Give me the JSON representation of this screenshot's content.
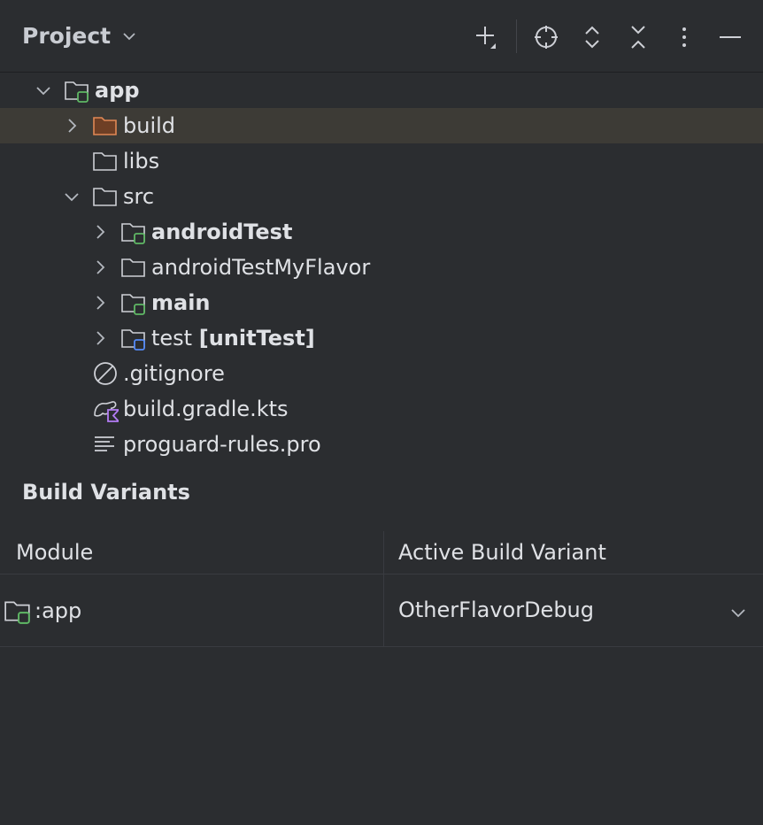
{
  "header": {
    "title": "Project",
    "toolbar": {
      "add_icon": "plus-icon",
      "locate_icon": "crosshair-icon",
      "expand_icon": "expand-all-icon",
      "collapse_icon": "collapse-all-icon",
      "more_icon": "more-vertical-icon",
      "hide_icon": "minimize-icon"
    }
  },
  "tree": {
    "app": {
      "label": "app"
    },
    "build": {
      "label": "build"
    },
    "libs": {
      "label": "libs"
    },
    "src": {
      "label": "src"
    },
    "androidTest": {
      "label": "androidTest"
    },
    "androidTestMyFlavor": {
      "label": "androidTestMyFlavor"
    },
    "main": {
      "label": "main"
    },
    "test": {
      "label": "test",
      "suffix": "[unitTest]"
    },
    "gitignore": {
      "label": ".gitignore"
    },
    "gradle": {
      "label": "build.gradle.kts"
    },
    "proguard": {
      "label": "proguard-rules.pro"
    }
  },
  "build_variants": {
    "title": "Build Variants",
    "columns": [
      "Module",
      "Active Build Variant"
    ],
    "rows": [
      {
        "module": ":app",
        "variant": "OtherFlavorDebug"
      }
    ]
  },
  "colors": {
    "background": "#2b2d30",
    "selection": "#3d3b36",
    "module_badge": "#5fb865",
    "test_badge": "#548af7",
    "excluded_folder": "#e08855",
    "kotlin_badge": "#b37cf4"
  }
}
